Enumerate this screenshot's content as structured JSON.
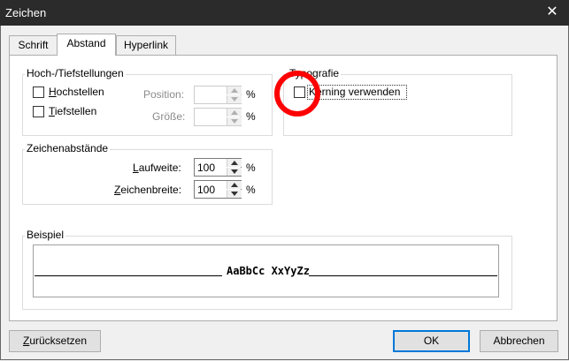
{
  "window": {
    "title": "Zeichen",
    "close_glyph": "✕"
  },
  "tabs": [
    {
      "label": "Schrift",
      "active": false
    },
    {
      "label": "Abstand",
      "active": true
    },
    {
      "label": "Hyperlink",
      "active": false
    }
  ],
  "hoch_tief": {
    "label": "Hoch-/Tiefstellungen",
    "hochstellen": {
      "mnemonic": "H",
      "rest": "ochstellen",
      "checked": false
    },
    "tiefstellen": {
      "mnemonic": "T",
      "rest": "iefstellen",
      "checked": false
    },
    "position": {
      "label": "Position:",
      "value": "",
      "unit": "%"
    },
    "groesse": {
      "label": "Größe:",
      "value": "",
      "unit": "%"
    }
  },
  "typografie": {
    "label": "Typografie",
    "kerning": {
      "label": "Kerning verwenden",
      "mnemonic": "e",
      "checked": false
    }
  },
  "zeichenabstaende": {
    "label": "Zeichenabstände",
    "laufweite": {
      "mnemonic": "L",
      "rest": "aufweite:",
      "value": "100",
      "unit": "%"
    },
    "zeichenbreite": {
      "mnemonic": "Z",
      "rest": "eichenbreite:",
      "value": "100",
      "unit": "%"
    }
  },
  "beispiel": {
    "label": "Beispiel",
    "sample_text": "AaBbCc XxYyZz"
  },
  "buttons": {
    "reset": {
      "mnemonic": "Z",
      "rest": "urücksetzen"
    },
    "ok": "OK",
    "cancel": "Abbrechen"
  },
  "colors": {
    "annotation": "#ff0000",
    "titlebar": "#2b2b2b",
    "default_button_border": "#0078d7"
  }
}
